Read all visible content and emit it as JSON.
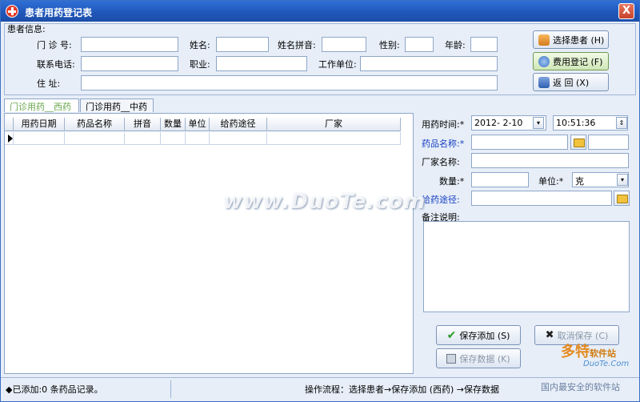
{
  "window": {
    "title": "患者用药登记表",
    "close_label": "X"
  },
  "patient": {
    "section_label": "患者信息:",
    "fields": {
      "clinic_no": {
        "label": "门 诊 号:",
        "value": ""
      },
      "name": {
        "label": "姓名:",
        "value": ""
      },
      "pinyin": {
        "label": "姓名拼音:",
        "value": ""
      },
      "gender": {
        "label": "性别:",
        "value": ""
      },
      "age": {
        "label": "年龄:",
        "value": ""
      },
      "phone": {
        "label": "联系电话:",
        "value": ""
      },
      "job": {
        "label": "职业:",
        "value": ""
      },
      "work_unit": {
        "label": "工作单位:",
        "value": ""
      },
      "address": {
        "label": "住    址:",
        "value": ""
      }
    },
    "buttons": {
      "select": "选择患者 (H)",
      "fee": "费用登记 (F)",
      "back": "返    回 (X)"
    }
  },
  "tabs": [
    {
      "label": "门诊用药__西药",
      "active": true
    },
    {
      "label": "门诊用药__中药",
      "active": false
    }
  ],
  "grid": {
    "columns": [
      "用药日期",
      "药品名称",
      "拼音",
      "数量",
      "单位",
      "给药途径",
      "厂家"
    ]
  },
  "form": {
    "time_label": "用药时间:*",
    "date_value": "2012- 2-10",
    "time_value": "10:51:36",
    "drug_label": "药品名称:*",
    "maker_label": "厂家名称:",
    "qty_label": "数量:*",
    "unit_label": "单位:*",
    "unit_value": "克",
    "route_label": "给药途径:",
    "note_label": "备注说明:",
    "buttons": {
      "save_add": "保存添加 (S)",
      "cancel_save": "取消保存 (C)",
      "save_data": "保存数据 (K)"
    }
  },
  "status": {
    "left": "◆已添加:0 条药品记录。",
    "right": "操作流程：选择患者→保存添加 (西药) →保存数据"
  },
  "watermarks": {
    "main": "www.DuoTe.com",
    "brand": "多特",
    "brand_small": "软件站",
    "brand_url": "DuoTe.Com",
    "slogan": "国内最安全的软件站"
  },
  "colors": {
    "titlebar": "#1f56b8",
    "accent_blue": "#1740c0",
    "tab_active": "#6aa84f"
  }
}
